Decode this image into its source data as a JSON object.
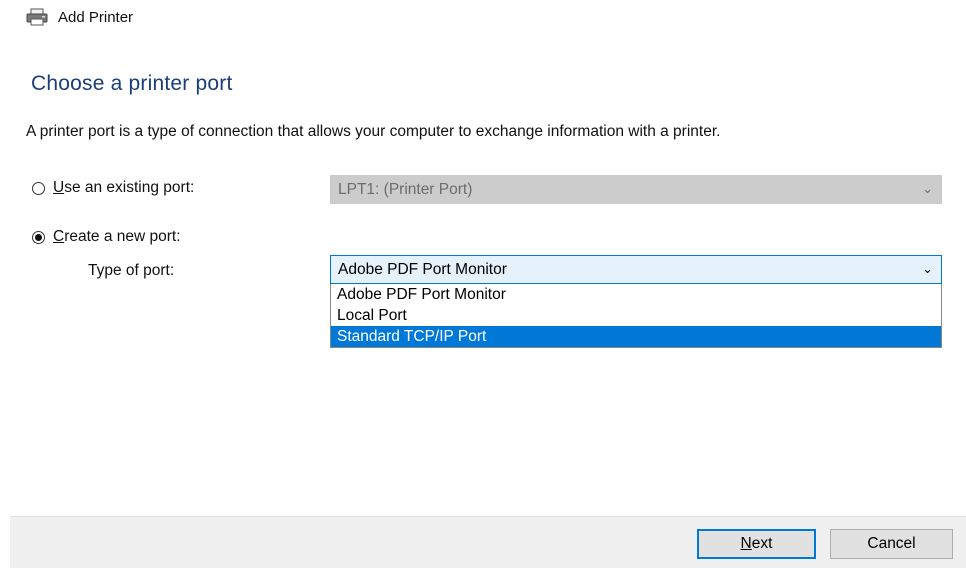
{
  "window": {
    "title": "Add Printer",
    "icon": "printer-icon"
  },
  "page": {
    "heading": "Choose a printer port",
    "description": "A printer port is a type of connection that allows your computer to exchange information with a printer."
  },
  "existing_port": {
    "label_accel": "U",
    "label_rest": "se an existing port:",
    "checked": false,
    "value": "LPT1: (Printer Port)",
    "enabled": false
  },
  "new_port": {
    "label_accel": "C",
    "label_rest": "reate a new port:",
    "checked": true,
    "type_label": "Type of port:",
    "selected_value": "Adobe PDF Port Monitor",
    "options": [
      "Adobe PDF Port Monitor",
      "Local Port",
      "Standard TCP/IP Port"
    ],
    "highlighted_option": "Standard TCP/IP Port"
  },
  "buttons": {
    "next_accel": "N",
    "next_rest": "ext",
    "cancel": "Cancel"
  },
  "colors": {
    "accent": "#0078d7",
    "heading": "#1a3e78"
  }
}
